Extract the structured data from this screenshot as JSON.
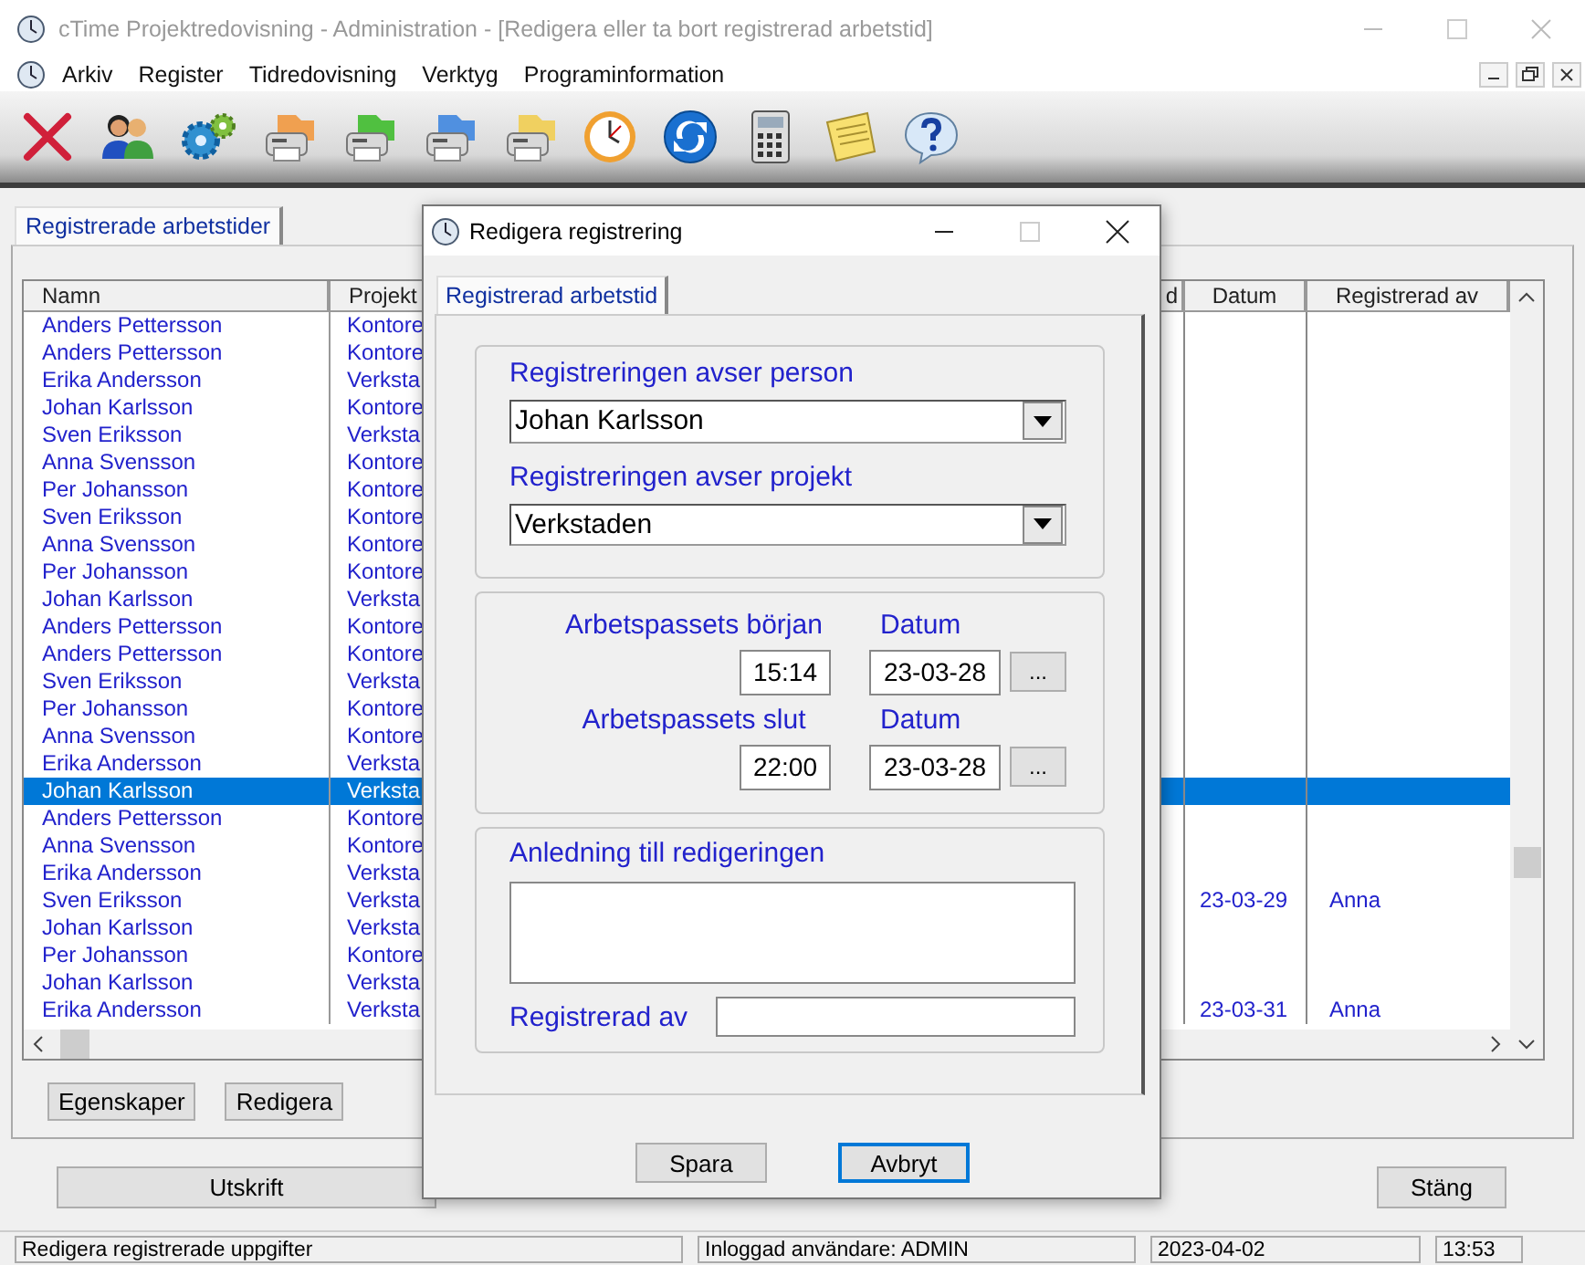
{
  "window": {
    "title": "cTime Projektredovisning - Administration - [Redigera eller ta bort registrerad arbetstid]"
  },
  "menu": [
    "Arkiv",
    "Register",
    "Tidredovisning",
    "Verktyg",
    "Programinformation"
  ],
  "tabs": [
    {
      "label": "Registrerade arbetstider",
      "selected": true
    }
  ],
  "table": {
    "columns": [
      "Namn",
      "Projekt",
      "d",
      "Datum",
      "Registrerad av"
    ],
    "rows": [
      {
        "name": "Anders Pettersson",
        "project": "Kontore",
        "selected": false
      },
      {
        "name": "Anders Pettersson",
        "project": "Kontore",
        "selected": false
      },
      {
        "name": "Erika Andersson",
        "project": "Verksta",
        "selected": false
      },
      {
        "name": "Johan Karlsson",
        "project": "Kontore",
        "selected": false
      },
      {
        "name": "Sven Eriksson",
        "project": "Verksta",
        "selected": false
      },
      {
        "name": "Anna Svensson",
        "project": "Kontore",
        "selected": false
      },
      {
        "name": "Per Johansson",
        "project": "Kontore",
        "selected": false
      },
      {
        "name": "Sven Eriksson",
        "project": "Kontore",
        "selected": false
      },
      {
        "name": "Anna Svensson",
        "project": "Kontore",
        "selected": false
      },
      {
        "name": "Per Johansson",
        "project": "Kontore",
        "selected": false
      },
      {
        "name": "Johan Karlsson",
        "project": "Verksta",
        "selected": false
      },
      {
        "name": "Anders Pettersson",
        "project": "Kontore",
        "selected": false
      },
      {
        "name": "Anders Pettersson",
        "project": "Kontore",
        "selected": false
      },
      {
        "name": "Sven Eriksson",
        "project": "Verksta",
        "selected": false
      },
      {
        "name": "Per Johansson",
        "project": "Kontore",
        "selected": false
      },
      {
        "name": "Anna Svensson",
        "project": "Kontore",
        "selected": false
      },
      {
        "name": "Erika Andersson",
        "project": "Verksta",
        "selected": false
      },
      {
        "name": "Johan Karlsson",
        "project": "Verksta",
        "selected": true
      },
      {
        "name": "Anders Pettersson",
        "project": "Kontore",
        "selected": false
      },
      {
        "name": "Anna Svensson",
        "project": "Kontore",
        "selected": false
      },
      {
        "name": "Erika Andersson",
        "project": "Verksta",
        "selected": false
      },
      {
        "name": "Sven Eriksson",
        "project": "Verksta",
        "date": "23-03-29",
        "registered_by": "Anna",
        "selected": false
      },
      {
        "name": "Johan Karlsson",
        "project": "Verksta",
        "selected": false
      },
      {
        "name": "Per Johansson",
        "project": "Kontore",
        "selected": false
      },
      {
        "name": "Johan Karlsson",
        "project": "Verksta",
        "selected": false
      },
      {
        "name": "Erika Andersson",
        "project": "Verksta",
        "date": "23-03-31",
        "registered_by": "Anna",
        "selected": false
      }
    ]
  },
  "buttons": [
    "Egenskaper",
    "Redigera"
  ],
  "footer_buttons": [
    "Utskrift",
    "Stäng"
  ],
  "status_bar": [
    "Redigera registrerade uppgifter",
    "Inloggad användare: ADMIN",
    "2023-04-02",
    "13:53"
  ],
  "dialog": {
    "title": "Redigera registrering",
    "tabs": [
      {
        "label": "Registrerad arbetstid",
        "selected": true
      }
    ],
    "person_label": "Registreringen avser person",
    "person": "Johan Karlsson",
    "project_label": "Registreringen avser projekt",
    "project": "Verkstaden",
    "start_label": "Arbetspassets början",
    "start_date_label": "Datum",
    "start_time": "15:14",
    "start_date": "23-03-28",
    "start_picker": "...",
    "end_label": "Arbetspassets slut",
    "end_date_label": "Datum",
    "end_time": "22:00",
    "end_date": "23-03-28",
    "end_picker": "...",
    "reason_label": "Anledning till redigeringen",
    "registered_by_label": "Registrerad av",
    "buttons": [
      {
        "label": "Spara",
        "focused": false
      },
      {
        "label": "Avbryt",
        "focused": true
      }
    ]
  }
}
